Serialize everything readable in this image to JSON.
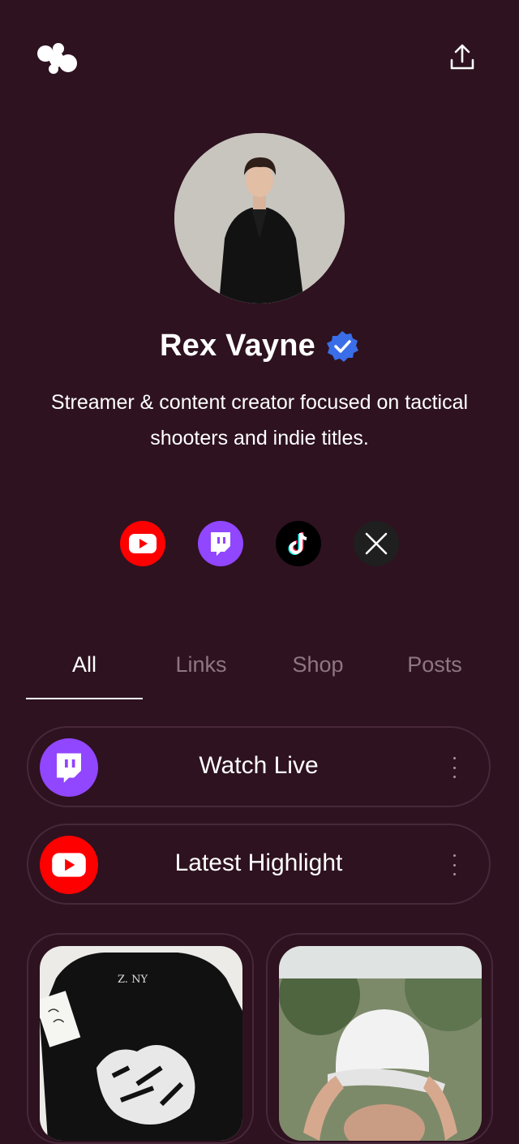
{
  "profile": {
    "name": "Rex Vayne",
    "bio": "Streamer & content creator focused on tactical shooters and indie titles."
  },
  "icons": {
    "logo": "app-logo-icon",
    "share": "share-upload-icon",
    "verified": "verified-badge-icon"
  },
  "socials": [
    {
      "name": "youtube",
      "icon": "youtube-icon",
      "color": "#ff0000"
    },
    {
      "name": "twitch",
      "icon": "twitch-icon",
      "color": "#9146ff"
    },
    {
      "name": "tiktok",
      "icon": "tiktok-icon",
      "color": "#000000"
    },
    {
      "name": "x",
      "icon": "x-icon",
      "color": "#1f1f1f"
    }
  ],
  "tabs": [
    {
      "label": "All",
      "active": true
    },
    {
      "label": "Links",
      "active": false
    },
    {
      "label": "Shop",
      "active": false
    },
    {
      "label": "Posts",
      "active": false
    }
  ],
  "links": [
    {
      "title": "Watch Live",
      "icon": "twitch-icon",
      "color": "#9146ff"
    },
    {
      "title": "Latest Highlight",
      "icon": "youtube-icon",
      "color": "#ff0000"
    }
  ],
  "colors": {
    "background": "#2e1220",
    "card_border": "#47283a",
    "tab_inactive": "#8e7780",
    "verified": "#3a6ee8"
  }
}
